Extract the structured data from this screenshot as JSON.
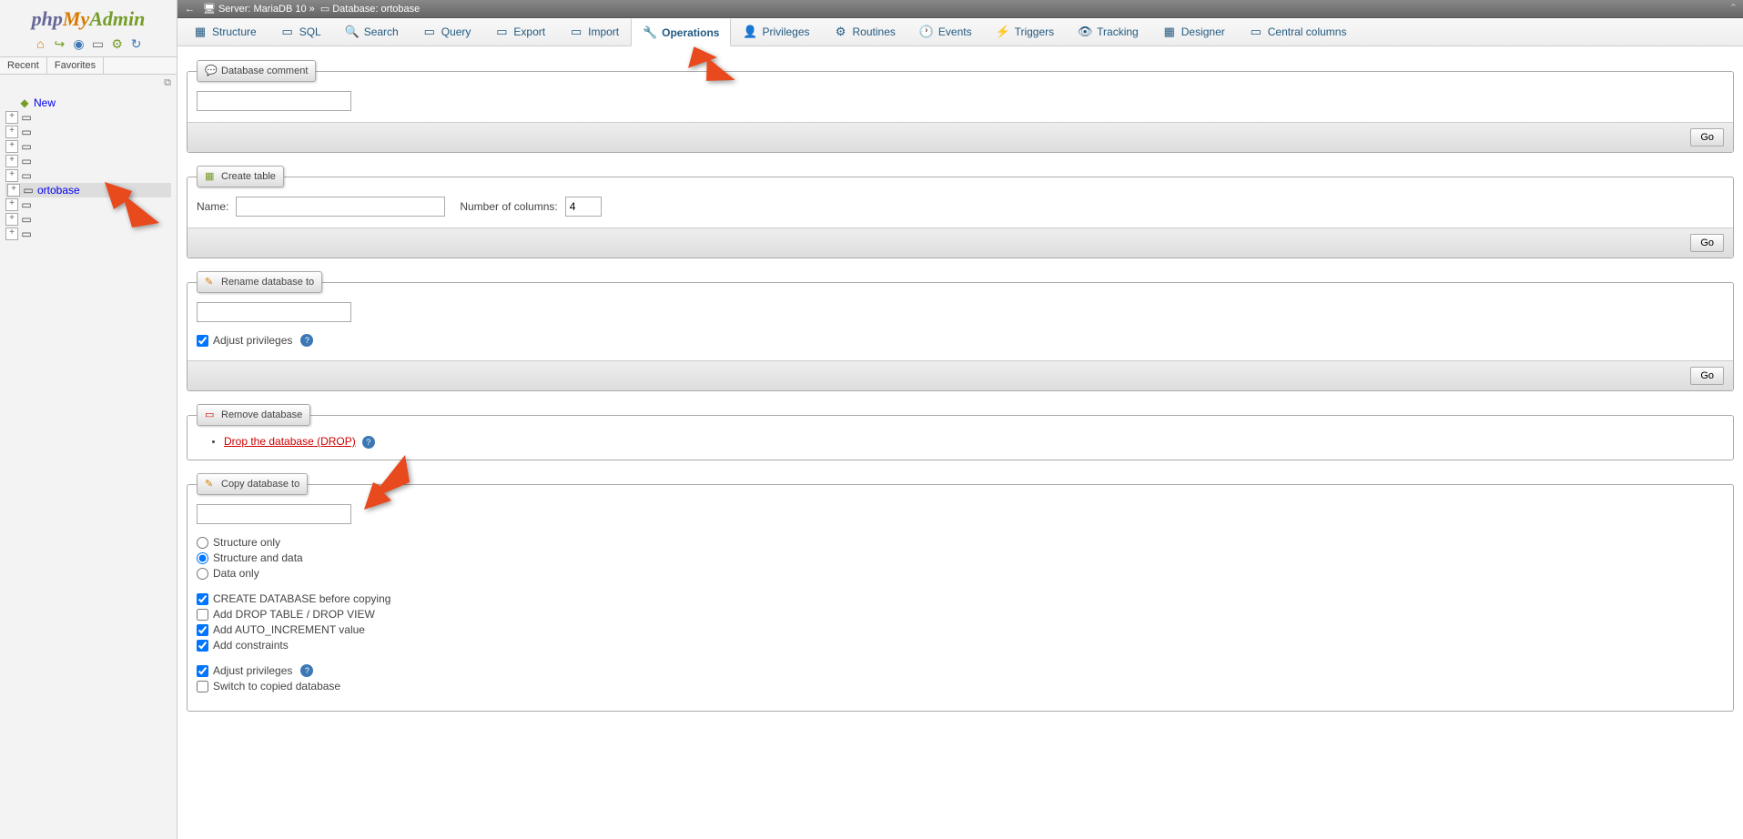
{
  "sidebar": {
    "logo": {
      "php": "php",
      "my": "My",
      "admin": "Admin"
    },
    "nav_tabs": {
      "recent": "Recent",
      "favorites": "Favorites"
    },
    "new_label": "New",
    "databases": [
      {
        "name": ""
      },
      {
        "name": ""
      },
      {
        "name": ""
      },
      {
        "name": ""
      },
      {
        "name": ""
      },
      {
        "name": "ortobase",
        "active": true
      },
      {
        "name": ""
      },
      {
        "name": ""
      },
      {
        "name": ""
      }
    ]
  },
  "breadcrumb": {
    "server_label": "Server:",
    "server_name": "MariaDB 10",
    "separator": "»",
    "database_label": "Database:",
    "database_name": "ortobase"
  },
  "tabs": [
    {
      "id": "structure",
      "label": "Structure",
      "icon": "▦"
    },
    {
      "id": "sql",
      "label": "SQL",
      "icon": "▭"
    },
    {
      "id": "search",
      "label": "Search",
      "icon": "🔍"
    },
    {
      "id": "query",
      "label": "Query",
      "icon": "▭"
    },
    {
      "id": "export",
      "label": "Export",
      "icon": "▭"
    },
    {
      "id": "import",
      "label": "Import",
      "icon": "▭"
    },
    {
      "id": "operations",
      "label": "Operations",
      "icon": "🔧",
      "active": true
    },
    {
      "id": "privileges",
      "label": "Privileges",
      "icon": "👤"
    },
    {
      "id": "routines",
      "label": "Routines",
      "icon": "⚙"
    },
    {
      "id": "events",
      "label": "Events",
      "icon": "🕐"
    },
    {
      "id": "triggers",
      "label": "Triggers",
      "icon": "⚡"
    },
    {
      "id": "tracking",
      "label": "Tracking",
      "icon": "👁"
    },
    {
      "id": "designer",
      "label": "Designer",
      "icon": "▦"
    },
    {
      "id": "central_columns",
      "label": "Central columns",
      "icon": "▭"
    }
  ],
  "panels": {
    "db_comment": {
      "legend": "Database comment",
      "value": "",
      "go": "Go"
    },
    "create_table": {
      "legend": "Create table",
      "name_label": "Name:",
      "name_value": "",
      "cols_label": "Number of columns:",
      "cols_value": "4",
      "go": "Go"
    },
    "rename_db": {
      "legend": "Rename database to",
      "value": "",
      "adjust_priv_label": "Adjust privileges",
      "adjust_priv_checked": true,
      "go": "Go"
    },
    "remove_db": {
      "legend": "Remove database",
      "drop_text": "Drop the database (DROP)"
    },
    "copy_db": {
      "legend": "Copy database to",
      "value": "",
      "radio_options": [
        {
          "label": "Structure only",
          "checked": false
        },
        {
          "label": "Structure and data",
          "checked": true
        },
        {
          "label": "Data only",
          "checked": false
        }
      ],
      "checkboxes1": [
        {
          "label": "CREATE DATABASE before copying",
          "checked": true
        },
        {
          "label": "Add DROP TABLE / DROP VIEW",
          "checked": false
        },
        {
          "label": "Add AUTO_INCREMENT value",
          "checked": true
        },
        {
          "label": "Add constraints",
          "checked": true
        }
      ],
      "checkboxes2": [
        {
          "label": "Adjust privileges",
          "checked": true,
          "help": true
        },
        {
          "label": "Switch to copied database",
          "checked": false
        }
      ]
    }
  }
}
